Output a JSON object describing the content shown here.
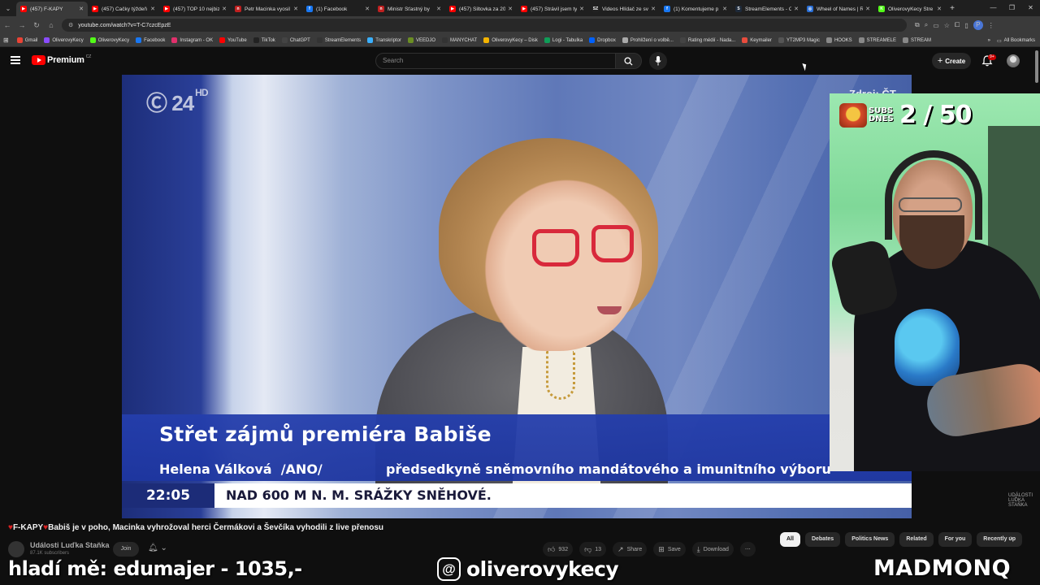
{
  "browser": {
    "tabs": [
      {
        "label": "(457) F-KAPY",
        "color": "#ff0000",
        "glyph": "▶",
        "active": true
      },
      {
        "label": "(457) Čačky týždeň",
        "color": "#ff0000",
        "glyph": "▶"
      },
      {
        "label": "(457) TOP 10 nejbiz",
        "color": "#ff0000",
        "glyph": "▶"
      },
      {
        "label": "Petr Macinka vyosil",
        "color": "#c02020",
        "glyph": "n"
      },
      {
        "label": "(1) Facebook",
        "color": "#1877f2",
        "glyph": "f"
      },
      {
        "label": "Ministr Šťastný by",
        "color": "#c02020",
        "glyph": "n"
      },
      {
        "label": "(457) Šiltovka za 20",
        "color": "#ff0000",
        "glyph": "▶"
      },
      {
        "label": "(457) Strávil jsem ty",
        "color": "#ff0000",
        "glyph": "▶"
      },
      {
        "label": "Videos Hlídač ze sv",
        "color": "#222222",
        "glyph": "SZ"
      },
      {
        "label": "(1) Komentujeme p",
        "color": "#1877f2",
        "glyph": "f"
      },
      {
        "label": "StreamElements - O",
        "color": "#1e2a3a",
        "glyph": "S"
      },
      {
        "label": "Wheel of Names | R",
        "color": "#2a6fd6",
        "glyph": "◎"
      },
      {
        "label": "OliverovyKecy Stre",
        "color": "#53fc18",
        "glyph": "K"
      }
    ],
    "url": "youtube.com/watch?v=T-C7czcEpzE",
    "bookmarks": [
      {
        "label": "Gmail",
        "color": "#ea4335"
      },
      {
        "label": "OliverovyKecy",
        "color": "#8a4cff"
      },
      {
        "label": "OliverovyKecy",
        "color": "#53fc18"
      },
      {
        "label": "Facebook",
        "color": "#1877f2"
      },
      {
        "label": "Instagram - OK",
        "color": "#e1306c"
      },
      {
        "label": "YouTube",
        "color": "#ff0000"
      },
      {
        "label": "TikTok",
        "color": "#222222"
      },
      {
        "label": "ChatGPT",
        "color": "#444444"
      },
      {
        "label": "StreamElements",
        "color": "#333333"
      },
      {
        "label": "Transkriptor",
        "color": "#3ab0ff"
      },
      {
        "label": "VEEDJO",
        "color": "#6b8e23"
      },
      {
        "label": "MANYCHAT",
        "color": "#333333"
      },
      {
        "label": "OliverovyKecy – Disk",
        "color": "#f4b400"
      },
      {
        "label": "Logi - Tabulka",
        "color": "#0f9d58"
      },
      {
        "label": "Dropbox",
        "color": "#0061fe"
      },
      {
        "label": "Prohlížení o volbě...",
        "color": "#aaaaaa"
      },
      {
        "label": "Rating médií - Nada...",
        "color": "#444444"
      },
      {
        "label": "Keymailer",
        "color": "#e84c3d"
      },
      {
        "label": "YT2MP3 Magic",
        "color": "#555555"
      },
      {
        "label": "HOOKS",
        "color": "#888888"
      },
      {
        "label": "STREAMELE",
        "color": "#888888"
      },
      {
        "label": "STREAM",
        "color": "#888888"
      }
    ],
    "all_bookmarks": "All Bookmarks",
    "profile_initial": "P"
  },
  "youtube": {
    "brand": "Premium",
    "country": "CZ",
    "search_placeholder": "Search",
    "create_label": "Create",
    "notif_count": "9+",
    "video_title": "F-KAPY",
    "video_subtitle": "Babiš je v poho, Macinka vyhrožoval herci Čermákovi a Ševčíka vyhodili z live přenosu",
    "channel_name": "Události Luďka Staňka",
    "channel_subs": "87.1K subscribers",
    "join_label": "Join",
    "actions": {
      "likes": "932",
      "dislikes": "13",
      "share": "Share",
      "save": "Save",
      "download": "Download"
    },
    "chips": [
      {
        "label": "All",
        "active": true
      },
      {
        "label": "Debates"
      },
      {
        "label": "Politics News"
      },
      {
        "label": "Related"
      },
      {
        "label": "For you"
      },
      {
        "label": "Recently up"
      }
    ]
  },
  "broadcast": {
    "station_logo": "24",
    "station_hd": "HD",
    "source": "Zdroj: ČT",
    "headline": "Střet zájmů premiéra Babiše",
    "person_name": "Helena Válková",
    "person_party": "/ANO/",
    "person_role": "předsedkyně sněmovního mandátového a imunitního výboru",
    "ticker_time": "22:05",
    "ticker_text": "NAD 600 M N. M. SRÁŽKY SNĚHOVÉ.",
    "watermark": "UDÁLOSTI LUĎKA STAŇKA"
  },
  "stream_overlay": {
    "subs_label": "SUBS DNES",
    "subs_count": "2 / 50",
    "donation": "hladí mě: edumajer - 1035,-",
    "social_handle": "oliverovykecy",
    "sponsor": "MADMONQ"
  }
}
